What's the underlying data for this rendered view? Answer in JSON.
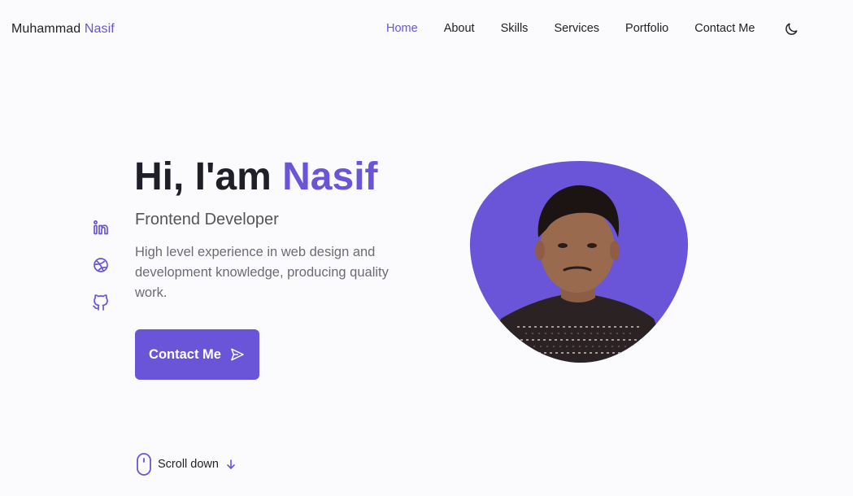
{
  "header": {
    "logo_first": "Muhammad",
    "logo_accent": "Nasif",
    "nav": [
      {
        "label": "Home",
        "active": true
      },
      {
        "label": "About"
      },
      {
        "label": "Skills"
      },
      {
        "label": "Services"
      },
      {
        "label": "Portfolio"
      },
      {
        "label": "Contact Me"
      }
    ],
    "theme_icon": "moon-icon"
  },
  "social": [
    "linkedin-icon",
    "dribbble-icon",
    "github-icon"
  ],
  "hero": {
    "greeting": "Hi, I'am",
    "name": "Nasif",
    "subtitle": "Frontend Developer",
    "description": "High level experience in web design and development knowledge, producing quality work.",
    "button_label": "Contact Me",
    "button_icon": "send-icon"
  },
  "scroll": {
    "label": "Scroll down",
    "icon": "mouse-icon",
    "arrow_icon": "arrow-down-icon"
  },
  "colors": {
    "accent": "#6a54d8",
    "background": "#fbfbfe",
    "text": "#222222"
  }
}
